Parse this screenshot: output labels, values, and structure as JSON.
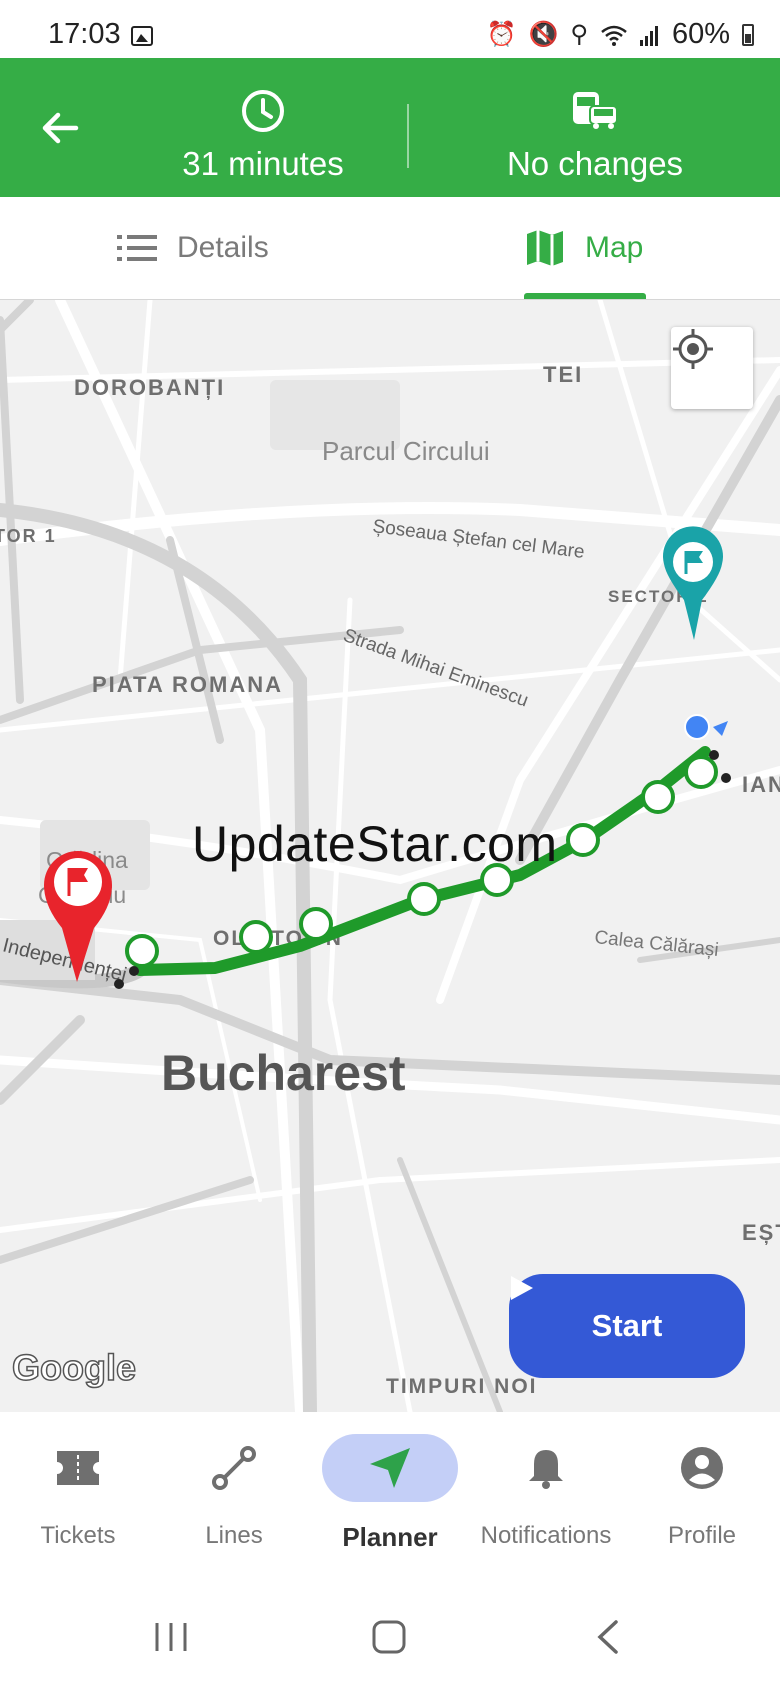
{
  "status_bar": {
    "time": "17:03",
    "battery": "60%"
  },
  "header": {
    "duration": "31 minutes",
    "changes": "No changes",
    "accent": "#35ad46"
  },
  "tabs": [
    {
      "label": "Details"
    },
    {
      "label": "Map",
      "active": true
    }
  ],
  "map": {
    "labels": {
      "dorobanti": "DOROBANȚI",
      "tei": "TEI",
      "parcul": "Parcul Circului",
      "sector1": "TOR 1",
      "stefan": "Șoseaua Ștefan cel Mare",
      "sector2": "SECTOR 2",
      "eminescu": "Strada Mihai Eminescu",
      "piata": "PIATA ROMANA",
      "ian": "IAN",
      "gradina1": "Grădina",
      "gradina2": "Cișmigiu",
      "independentei": "Splaiul Independenței",
      "oldtown": "OLD TOWN",
      "calarasi": "Calea Călărași",
      "bucharest": "Bucharest",
      "est": "EȘT",
      "timpuri": "TIMPURI NOI"
    },
    "google_logo": "Google",
    "watermark": "UpdateStar.com",
    "start_label": "Start",
    "route_color": "#1f9a2a",
    "origin_pin_color": "#1aa3a8",
    "destination_pin_color": "#e8242c"
  },
  "bottom_nav": [
    {
      "label": "Tickets",
      "icon": "ticket-icon"
    },
    {
      "label": "Lines",
      "icon": "route-icon"
    },
    {
      "label": "Planner",
      "icon": "navigation-arrow-icon",
      "active": true
    },
    {
      "label": "Notifications",
      "icon": "bell-icon"
    },
    {
      "label": "Profile",
      "icon": "account-circle-icon"
    }
  ]
}
